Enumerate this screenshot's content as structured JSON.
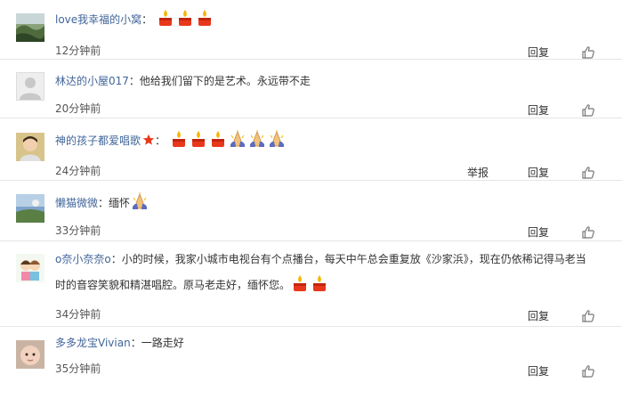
{
  "comments": [
    {
      "author": "love我幸福的小窝",
      "sep": "：",
      "text": "",
      "time": "12分钟前",
      "reply_label": "回复",
      "emojis": [
        "candle",
        "candle",
        "candle"
      ]
    },
    {
      "author": "林达的小屋017",
      "sep": "：",
      "text": "他给我们留下的是艺术。永远带不走",
      "time": "20分钟前",
      "reply_label": "回复",
      "emojis": []
    },
    {
      "author": "神的孩子都爱唱歌",
      "sep": "：",
      "text": "",
      "time": "24分钟前",
      "reply_label": "回复",
      "report_label": "举报",
      "emojis": [
        "candle",
        "candle",
        "candle",
        "pray",
        "pray",
        "pray"
      ]
    },
    {
      "author": "懒猫微微",
      "sep": "：",
      "text": "缅怀",
      "time": "33分钟前",
      "reply_label": "回复",
      "emojis": [
        "pray"
      ]
    },
    {
      "author": "o奈小奈奈o",
      "sep": "：",
      "text": "小的时候，我家小城市电视台有个点播台，每天中午总会重复放《沙家浜》，现在仍依稀记得马老当时的音容笑貌和精湛唱腔。原马老走好，缅怀您。",
      "time": "34分钟前",
      "reply_label": "回复",
      "emojis": [
        "candle",
        "candle"
      ]
    },
    {
      "author": "多多龙宝Vivian",
      "sep": "：",
      "text": "一路走好",
      "time": "35分钟前",
      "reply_label": "回复",
      "emojis": []
    }
  ],
  "colors": {
    "author": "#406599",
    "text": "#333333",
    "divider": "#e6e6e6",
    "candle": "#e8381c",
    "flame": "#f7b500"
  },
  "icons": {
    "like": "thumbs-up-icon",
    "candle": "candle-icon",
    "pray": "praying-hands-icon",
    "badge": "star-badge-icon"
  }
}
